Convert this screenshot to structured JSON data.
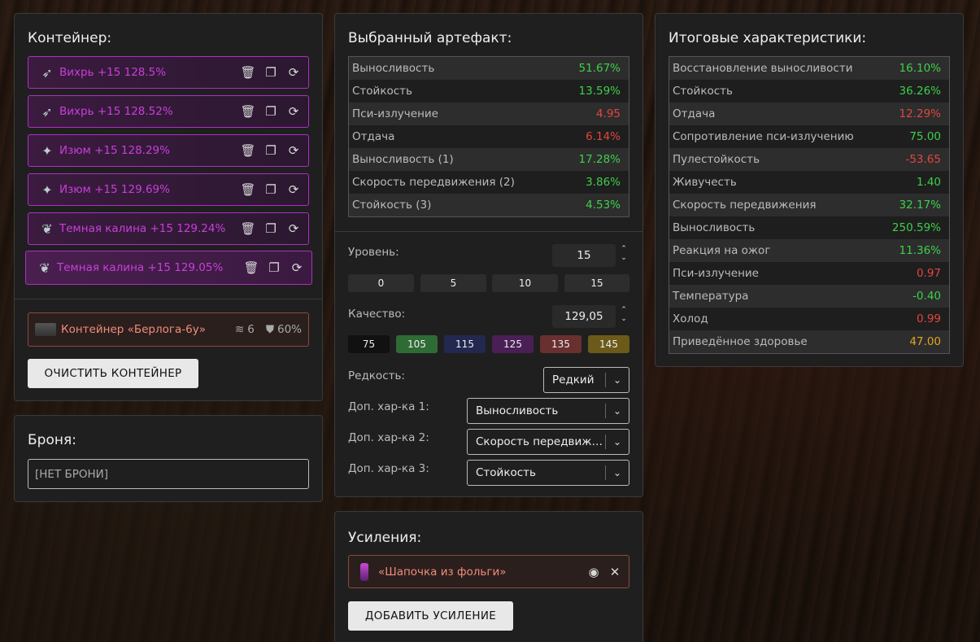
{
  "container": {
    "title": "Контейнер:",
    "artifacts": [
      {
        "name": "Вихрь +15 128.5%",
        "icon": "vortex-artifact-icon"
      },
      {
        "name": "Вихрь +15 128.52%",
        "icon": "vortex-artifact-icon"
      },
      {
        "name": "Изюм +15 128.29%",
        "icon": "raisin-artifact-icon"
      },
      {
        "name": "Изюм +15 129.69%",
        "icon": "raisin-artifact-icon"
      },
      {
        "name": "Темная калина +15 129.24%",
        "icon": "dark-viburnum-artifact-icon"
      },
      {
        "name": "Темная калина +15 129.05%",
        "icon": "dark-viburnum-artifact-icon"
      }
    ],
    "container_item": {
      "name": "Контейнер «Берлога-6у»",
      "slots": "6",
      "protection": "60%"
    },
    "clear_label": "ОЧИСТИТЬ КОНТЕЙНЕР"
  },
  "armor": {
    "title": "Броня:",
    "value": "[НЕТ БРОНИ]"
  },
  "selected": {
    "title": "Выбранный артефакт:",
    "stats": [
      {
        "name": "Выносливость",
        "value": "51.67%",
        "tone": "g"
      },
      {
        "name": "Стойкость",
        "value": "13.59%",
        "tone": "g"
      },
      {
        "name": "Пси-излучение",
        "value": "4.95",
        "tone": "r"
      },
      {
        "name": "Отдача",
        "value": "6.14%",
        "tone": "r"
      },
      {
        "name": "Выносливость (1)",
        "value": "17.28%",
        "tone": "g"
      },
      {
        "name": "Скорость передвижения (2)",
        "value": "3.86%",
        "tone": "g"
      },
      {
        "name": "Стойкость (3)",
        "value": "4.53%",
        "tone": "g"
      }
    ],
    "level_label": "Уровень:",
    "level_value": "15",
    "level_presets": [
      "0",
      "5",
      "10",
      "15"
    ],
    "quality_label": "Качество:",
    "quality_value": "129,05",
    "quality_presets": [
      {
        "label": "75",
        "color": "#111111"
      },
      {
        "label": "105",
        "color": "#2f6b35"
      },
      {
        "label": "115",
        "color": "#22284f"
      },
      {
        "label": "125",
        "color": "#4a1f55"
      },
      {
        "label": "135",
        "color": "#6a2f2f"
      },
      {
        "label": "145",
        "color": "#6b5a1a"
      }
    ],
    "rarity_label": "Редкость:",
    "rarity_value": "Редкий",
    "extra1_label": "Доп. хар-ка 1:",
    "extra1_value": "Выносливость",
    "extra2_label": "Доп. хар-ка 2:",
    "extra2_value": "Скорость передвижения",
    "extra3_label": "Доп. хар-ка 3:",
    "extra3_value": "Стойкость"
  },
  "boosts": {
    "title": "Усиления:",
    "items": [
      {
        "name": "«Шапочка из фольги»"
      }
    ],
    "add_label": "ДОБАВИТЬ УСИЛЕНИЕ"
  },
  "totals": {
    "title": "Итоговые характеристики:",
    "stats": [
      {
        "name": "Восстановление выносливости",
        "value": "16.10%",
        "tone": "g"
      },
      {
        "name": "Стойкость",
        "value": "36.26%",
        "tone": "g"
      },
      {
        "name": "Отдача",
        "value": "12.29%",
        "tone": "r"
      },
      {
        "name": "Сопротивление пси-излучению",
        "value": "75.00",
        "tone": "g"
      },
      {
        "name": "Пулестойкость",
        "value": "-53.65",
        "tone": "r"
      },
      {
        "name": "Живучесть",
        "value": "1.40",
        "tone": "g"
      },
      {
        "name": "Скорость передвижения",
        "value": "32.17%",
        "tone": "g"
      },
      {
        "name": "Выносливость",
        "value": "250.59%",
        "tone": "g"
      },
      {
        "name": "Реакция на ожог",
        "value": "11.36%",
        "tone": "g"
      },
      {
        "name": "Пси-излучение",
        "value": "0.97",
        "tone": "r"
      },
      {
        "name": "Температура",
        "value": "-0.40",
        "tone": "g"
      },
      {
        "name": "Холод",
        "value": "0.99",
        "tone": "r"
      },
      {
        "name": "Приведённое здоровье",
        "value": "47.00",
        "tone": "o"
      }
    ]
  }
}
